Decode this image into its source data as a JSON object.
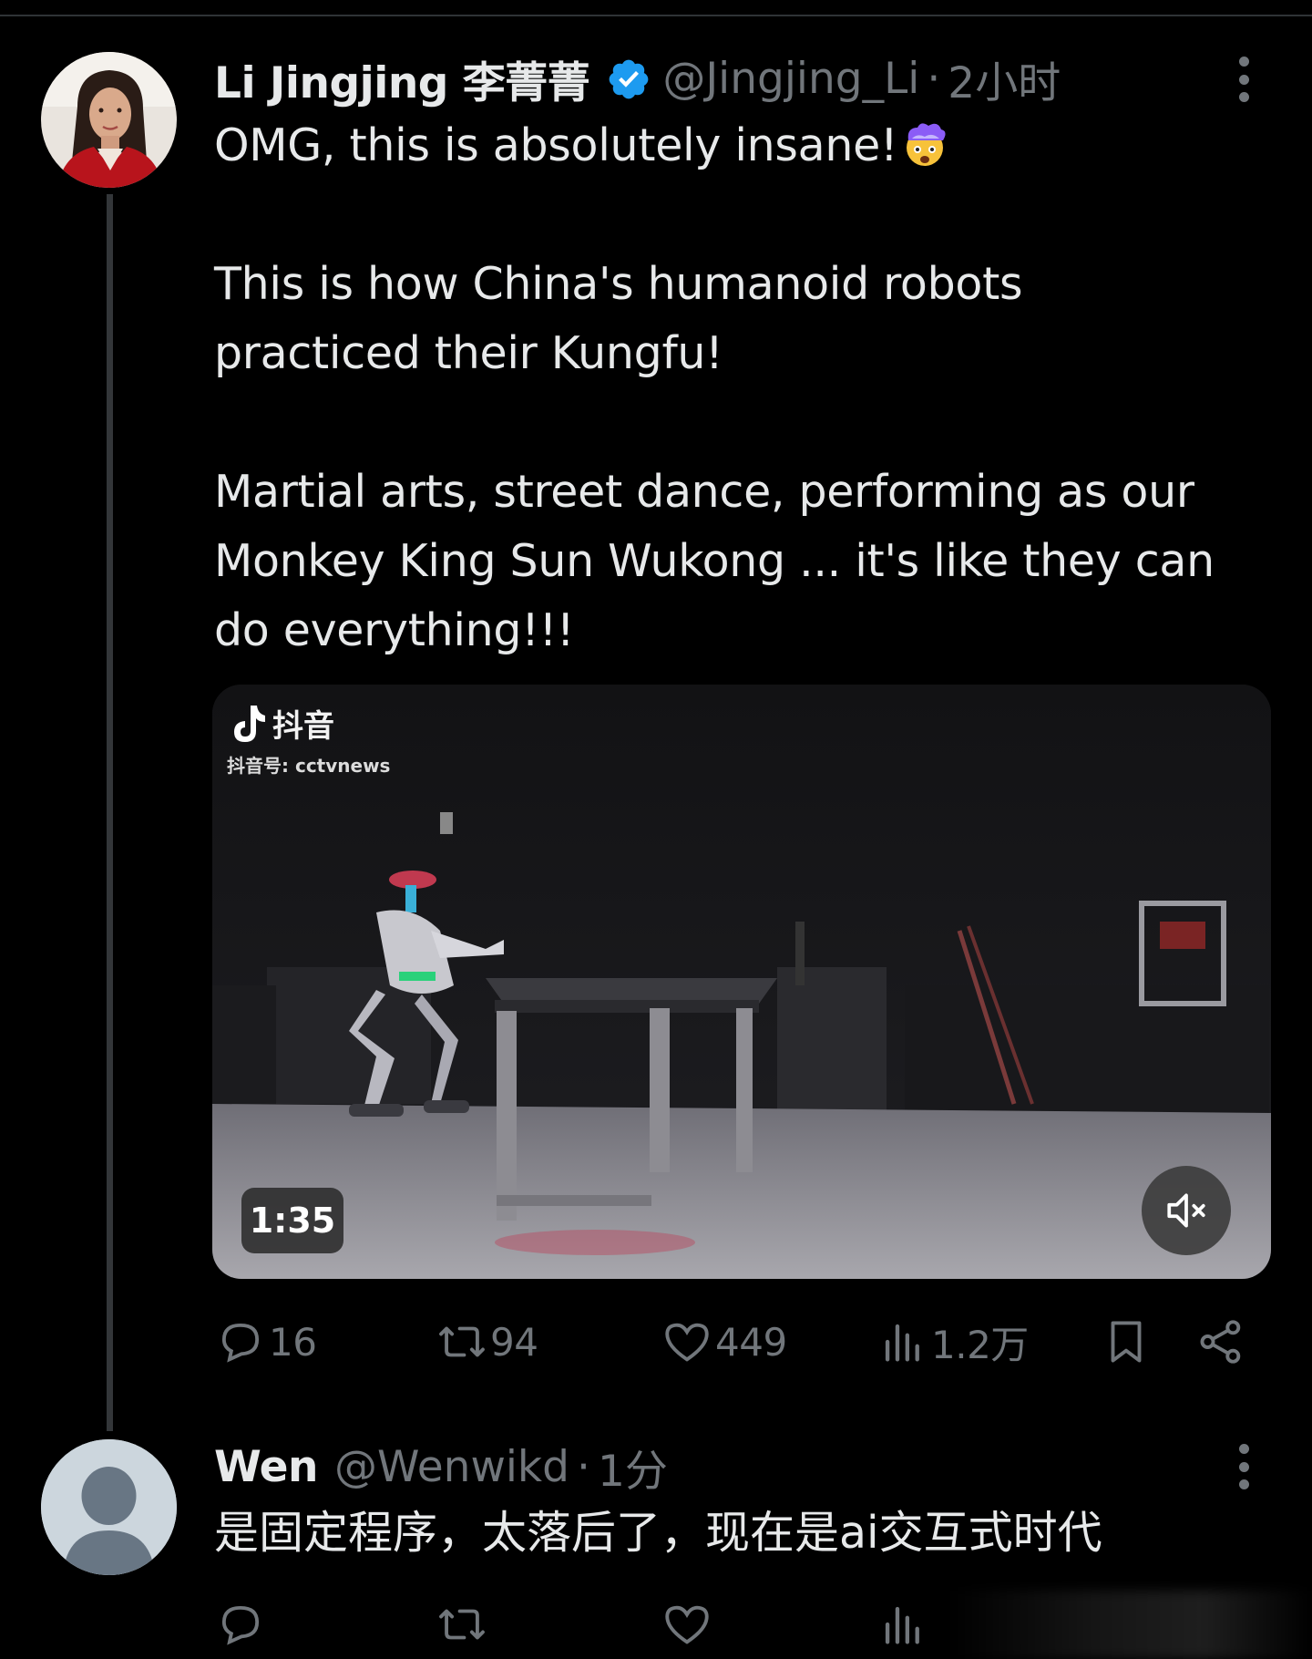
{
  "tweet": {
    "author": {
      "display_name": "Li Jingjing 李菁菁",
      "handle": "@Jingjing_Li",
      "time": "2小时",
      "verified": true,
      "verified_color": "#1d9bf0"
    },
    "text_lines": [
      "OMG, this is absolutely insane!",
      "",
      "This is how China's humanoid robots",
      "practiced their Kungfu!",
      "",
      "Martial arts, street dance, performing as our",
      "Monkey King Sun Wukong ... it's like they can",
      "do everything!!!"
    ],
    "emoji": "exploding-head-emoji",
    "media": {
      "watermark_brand": "抖音",
      "watermark_account": "抖音号: cctvnews",
      "duration": "1:35",
      "muted": true
    },
    "stats": {
      "replies": "16",
      "retweets": "94",
      "likes": "449",
      "views": "1.2万"
    }
  },
  "reply": {
    "author": {
      "display_name": "Wen",
      "handle": "@Wenwikd",
      "time": "1分"
    },
    "text": "是固定程序，太落后了，现在是ai交互式时代"
  },
  "icons": {
    "reply": "reply-icon",
    "retweet": "retweet-icon",
    "like": "heart-icon",
    "views": "views-icon",
    "bookmark": "bookmark-icon",
    "share": "share-icon",
    "more": "more-icon",
    "mute": "mute-icon"
  },
  "colors": {
    "background": "#000000",
    "text": "#e7e9ea",
    "secondary": "#71767b",
    "divider": "#2f3336"
  }
}
